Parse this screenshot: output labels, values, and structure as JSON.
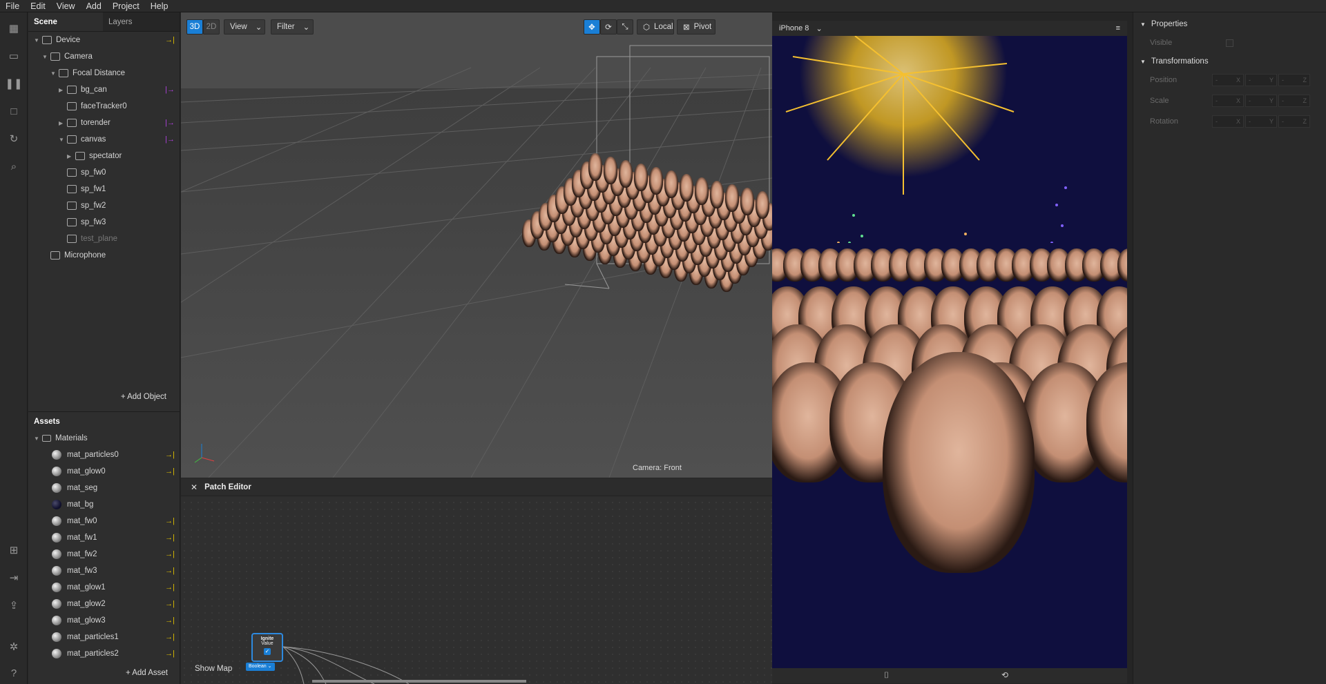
{
  "menu": [
    "File",
    "Edit",
    "View",
    "Add",
    "Project",
    "Help"
  ],
  "scene_tabs": {
    "scene": "Scene",
    "layers": "Layers"
  },
  "scene_tree": [
    {
      "label": "Device",
      "icon": "device-icon",
      "depth": 0,
      "arrow": "▼",
      "link": "→|",
      "link_color": "#e0c000"
    },
    {
      "label": "Camera",
      "icon": "camera-icon",
      "depth": 1,
      "arrow": "▼"
    },
    {
      "label": "Focal Distance",
      "icon": "focal-distance-icon",
      "depth": 2,
      "arrow": "▼"
    },
    {
      "label": "bg_can",
      "icon": "image-plane-icon",
      "depth": 3,
      "arrow": "▶",
      "link": "|→",
      "link_color": "#b040e0"
    },
    {
      "label": "faceTracker0",
      "icon": "face-tracker-icon",
      "depth": 3,
      "arrow": ""
    },
    {
      "label": "torender",
      "icon": "null-object-icon",
      "depth": 3,
      "arrow": "▶",
      "link": "|→",
      "link_color": "#b040e0"
    },
    {
      "label": "canvas",
      "icon": "null-object-icon",
      "depth": 3,
      "arrow": "▼",
      "link": "|→",
      "link_color": "#b040e0"
    },
    {
      "label": "spectator",
      "icon": "null-object-icon",
      "depth": 4,
      "arrow": "▶"
    },
    {
      "label": "sp_fw0",
      "icon": "speaker-icon",
      "depth": 3,
      "arrow": ""
    },
    {
      "label": "sp_fw1",
      "icon": "speaker-icon",
      "depth": 3,
      "arrow": ""
    },
    {
      "label": "sp_fw2",
      "icon": "speaker-icon",
      "depth": 3,
      "arrow": ""
    },
    {
      "label": "sp_fw3",
      "icon": "speaker-icon",
      "depth": 3,
      "arrow": ""
    },
    {
      "label": "test_plane",
      "icon": "plane-icon",
      "depth": 3,
      "arrow": "",
      "dim": true
    },
    {
      "label": "Microphone",
      "icon": "microphone-icon",
      "depth": 1,
      "arrow": ""
    }
  ],
  "add_object": "+ Add Object",
  "assets_title": "Assets",
  "materials_folder": "Materials",
  "materials": [
    {
      "label": "mat_particles0",
      "link": true
    },
    {
      "label": "mat_glow0",
      "link": true
    },
    {
      "label": "mat_seg",
      "link": false
    },
    {
      "label": "mat_bg",
      "link": false,
      "dark": true
    },
    {
      "label": "mat_fw0",
      "link": true
    },
    {
      "label": "mat_fw1",
      "link": true
    },
    {
      "label": "mat_fw2",
      "link": true
    },
    {
      "label": "mat_fw3",
      "link": true
    },
    {
      "label": "mat_glow1",
      "link": true
    },
    {
      "label": "mat_glow2",
      "link": true
    },
    {
      "label": "mat_glow3",
      "link": true
    },
    {
      "label": "mat_particles1",
      "link": true
    },
    {
      "label": "mat_particles2",
      "link": true
    }
  ],
  "add_asset": "+ Add Asset",
  "viewport": {
    "btn_3d": "3D",
    "btn_2d": "2D",
    "view": "View",
    "filter": "Filter",
    "local": "Local",
    "pivot": "Pivot",
    "camera_label": "Camera: Front"
  },
  "patch_editor": {
    "title": "Patch Editor",
    "show_map": "Show Map",
    "node_title": "Ignite",
    "node_sub": "Value",
    "node_type": "Boolean"
  },
  "simulator": {
    "device": "iPhone 8"
  },
  "properties": {
    "title": "Properties",
    "visible": "Visible",
    "transformations": "Transformations",
    "rows": [
      {
        "label": "Position",
        "axes": [
          "X",
          "Y",
          "Z"
        ]
      },
      {
        "label": "Scale",
        "axes": [
          "X",
          "Y",
          "Z"
        ]
      },
      {
        "label": "Rotation",
        "axes": [
          "X",
          "Y",
          "Z"
        ]
      }
    ]
  },
  "colors": {
    "accent": "#1a7fd6",
    "link_yellow": "#e0c000",
    "link_purple": "#b040e0",
    "sim_bg": "#0f0f3e"
  }
}
